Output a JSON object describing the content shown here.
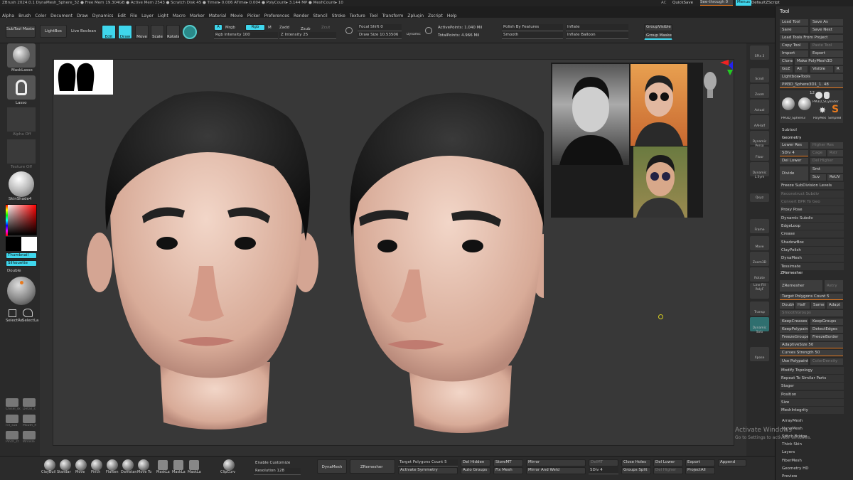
{
  "titlebar": {
    "text": "ZBrush 2024.0.1   DynaMesh_Sphere_32   ● Free Mem 19.304GB ● Active Mem 2543 ● Scratch Disk 45 ● Timer▸ 0.006 ATime▸ 0.004 ● PolyCount▸ 3.144 MP ● MeshCount▸ 10",
    "ac": "AC",
    "quicksave": "QuickSave",
    "seethrough": "See-through  0",
    "menus_btn": "Menus",
    "script": "DefaultZScript"
  },
  "menubar": [
    "Alpha",
    "Brush",
    "Color",
    "Document",
    "Draw",
    "Dynamics",
    "Edit",
    "File",
    "Layer",
    "Light",
    "Macro",
    "Marker",
    "Material",
    "Movie",
    "Picker",
    "Preferences",
    "Render",
    "Stencil",
    "Stroke",
    "Texture",
    "Tool",
    "Transform",
    "Zplugin",
    "Zscript",
    "Help"
  ],
  "topshelf": {
    "subtool_master": "SubTool Master",
    "lightbox": "LightBox",
    "live_boolean": "Live Boolean",
    "edit": "Edit",
    "draw": "Draw",
    "move": "Move",
    "scale": "Scale",
    "rotate": "Rotate",
    "a": "A",
    "mrgb": "Mrgb",
    "rgb": "Rgb",
    "m": "M",
    "zadd": "Zadd",
    "zsub": "Zsub",
    "zcut": "Zcut",
    "rgb_intensity": "Rgb Intensity 100",
    "z_intensity": "Z Intensity 25",
    "focal_shift": "Focal Shift 0",
    "draw_size": "Draw Size 10.53506",
    "dynamic": "Dynamic",
    "active_points": "ActivePoints: 1.040 Mil",
    "total_points": "TotalPoints: 4.966 Mil",
    "polish_features": "Polish By Features",
    "smooth": "Smooth",
    "inflate": "Inflate",
    "inflate_balloon": "Inflate Balloon",
    "group_visible": "GroupVisible",
    "group_masked": "Group Masked"
  },
  "leftshelf": {
    "masklasso": "MaskLasso",
    "lasso": "Lasso",
    "alpha_off": "Alpha Off",
    "texture_off": "Texture Off",
    "skinshade": "SkinShade4",
    "thumbnail": "Thumbnail",
    "silhouette": "Silhouette",
    "double": "Double",
    "select_rect": "SelectRe",
    "select_lasso": "SelectLa",
    "deco": [
      "Chisel_sk",
      "Detail_s",
      "Fill_sub",
      "Mouth_R",
      "Pinch_st",
      "Wrinkle"
    ]
  },
  "viewport": {
    "brush_x": "929",
    "colors": {
      "cyan": "#3fd6ec",
      "orange": "#e87a1e"
    }
  },
  "rightshelf": [
    "SPix 3",
    "Scroll",
    "Zoom",
    "Actual",
    "AAHalf",
    "Dynamic Persp",
    "Floor",
    "Dynamic L.Sym",
    "Qxyz",
    "Frame",
    "Move",
    "Zoom3D",
    "Rotate",
    "Line Fill PolyF",
    "Transp",
    "Dynamic Solo",
    "Xpose"
  ],
  "toolpanel": {
    "header": "Tool",
    "rows": [
      [
        "Load Tool",
        "Save As"
      ],
      [
        "Save",
        "Save Next"
      ],
      [
        "Load Tools From Project",
        ""
      ],
      [
        "Copy Tool",
        "Paste Tool"
      ],
      [
        "Import",
        "Export"
      ],
      [
        "Clone",
        "Make PolyMesh3D"
      ],
      [
        "GoZ",
        "All",
        "Visible",
        "R"
      ],
      [
        "Lightbox▸Tools",
        ""
      ]
    ],
    "current": "PM3D_Sphere3D1_1. 48",
    "count": "12",
    "thumbs": [
      "PM3D_Sphere3",
      "PolyMes",
      "SimpleB",
      "PM3D_S",
      "Cylinder"
    ],
    "subtool": "Subtool",
    "geometry": "Geometry",
    "geo_rows": [
      [
        "Lower Res",
        "Higher Res"
      ],
      [
        "SDiv 4",
        "Cage",
        "Rstr"
      ],
      [
        "Del Lower",
        "Del Higher"
      ]
    ],
    "divide": "Divide",
    "smt": "Smt",
    "suv": "Suv",
    "reuv": "ReUV",
    "list1": [
      "Freeze SubDivision Levels",
      "Reconstruct Subdiv",
      "Convert BPR To Geo",
      "Proxy Pose",
      "Dynamic Subdiv",
      "EdgeLoop",
      "Crease",
      "ShadowBox",
      "ClayPolish",
      "DynaMesh",
      "Tessimate"
    ],
    "zremesher_head": "ZRemesher",
    "zremesher": "ZRemesher",
    "retry": "Retry",
    "target_polys": "Target Polygons Count 5",
    "dhsa": [
      "Double",
      "Half",
      "Same",
      "Adapt"
    ],
    "smooth_groups": "SmoothGroups",
    "keep": [
      [
        "KeepCreases",
        "KeepGroups"
      ],
      [
        "KeepPolypaint",
        "DetectEdges"
      ],
      [
        "FreezeGroups",
        "FreezeBorder"
      ]
    ],
    "adaptive_size": "AdaptiveSize 50",
    "curves_strength": "Curves Strength 50",
    "use_polypaint": "Use Polypaint",
    "color_density": "ColorDensity",
    "list2": [
      "Modify Topology",
      "Repeat To Similar Parts",
      "Stager",
      "Position",
      "Size",
      "MeshIntegrity"
    ],
    "list3": [
      "ArrayMesh",
      "NanoMesh",
      "Stitch Bridge",
      "Thick Skin",
      "Layers",
      "FiberMesh",
      "Geometry HD",
      "Preview"
    ]
  },
  "activate": {
    "line1": "Activate Windows",
    "line2": "Go to Settings to activate Windows."
  },
  "bottombar": {
    "brushes": [
      "ClayBuil",
      "Standar",
      "Move",
      "Pinch",
      "Flatten",
      "Damstan",
      "Move To",
      "MaskLa",
      "MaskLa",
      "MaskLa",
      "ClipCurv"
    ],
    "enable_customize": "Enable Customize",
    "resolution": "Resolution 128",
    "dynamesh": "DynaMesh",
    "zremesher": "ZRemesher",
    "target_polys": "Target Polygons Count 5",
    "activate_symmetry": "Activate Symmetry",
    "del_hidden": "Del Hidden",
    "auto_groups": "Auto Groups",
    "store_mt": "StoreMT",
    "fix_mesh": "Fix Mesh",
    "mirror": "Mirror",
    "mirror_weld": "Mirror And Weld",
    "del_mt": "DelMT",
    "sdiv": "SDiv 4",
    "close_holes": "Close Holes",
    "groups_split": "Groups Split",
    "del_lower": "Del Lower",
    "del_higher": "Del Higher",
    "export": "Export",
    "project_all": "ProjectAll",
    "append": "Append"
  }
}
